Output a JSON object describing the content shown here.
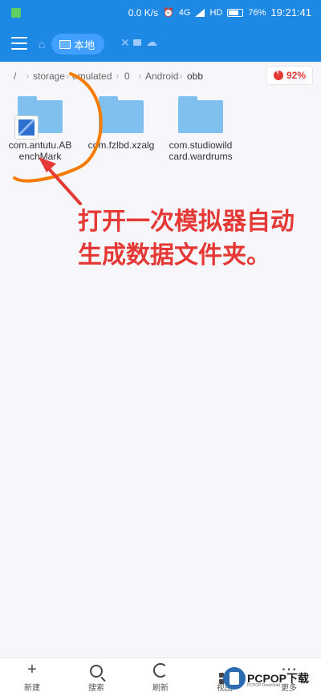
{
  "status": {
    "speed": "0.0 K/s",
    "network": "4G",
    "battery": "76%",
    "time": "19:21:41"
  },
  "toolbar": {
    "tab_label": "本地"
  },
  "breadcrumb": {
    "items": [
      "/",
      "storage",
      "emulated",
      "0",
      "Android",
      "obb"
    ]
  },
  "storage": {
    "percent": "92%"
  },
  "folders": [
    {
      "line1": "com.antutu.AB",
      "line2": "enchMark"
    },
    {
      "line1": "com.fzlbd.xzalg",
      "line2": ""
    },
    {
      "line1": "com.studiowild",
      "line2": "card.wardrums"
    }
  ],
  "annotation": {
    "text": "打开一次模拟器自动生成数据文件夹。",
    "color": "#e53935",
    "curve_color": "#f57c00"
  },
  "bottom_nav": [
    {
      "label": "新建",
      "icon": "plus-icon"
    },
    {
      "label": "搜索",
      "icon": "search-icon"
    },
    {
      "label": "刷新",
      "icon": "refresh-icon"
    },
    {
      "label": "视图",
      "icon": "view-icon"
    },
    {
      "label": "更多",
      "icon": "more-icon"
    }
  ],
  "watermark": {
    "brand": "PCPOP下载",
    "sub": "PCPOP Download"
  },
  "colors": {
    "header": "#1e88e5",
    "folder": "#7fc0ef",
    "accent_red": "#e53935"
  }
}
